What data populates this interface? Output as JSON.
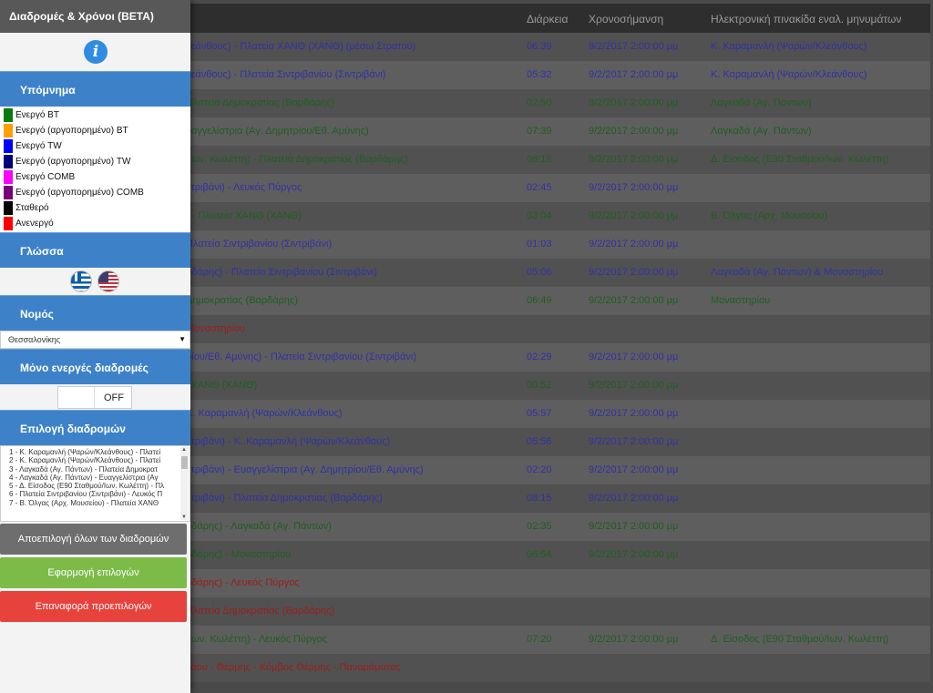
{
  "table": {
    "header": {
      "duration": "Διάρκεια",
      "timestamp": "Χρονοσήμανση",
      "sign": "Ηλεκτρονική πινακίδα εναλ. μηνυμάτων"
    },
    "rows": [
      {
        "route": "λεάνθους) - Πλατεία ΧΑΝΘ (ΧΑΝΘ) (μέσω Στρατού)",
        "duration": "06:39",
        "timestamp": "9/2/2017 2:00:00 μμ",
        "sign": "Κ. Καραμανλή (Ψαρών/Κλεάνθους)",
        "status": "blue"
      },
      {
        "route": "λεάνθους) - Πλατεία Σιντριβανίου (Σιντριβάνι)",
        "duration": "05:32",
        "timestamp": "9/2/2017 2:00:00 μμ",
        "sign": "Κ. Καραμανλή (Ψαρών/Κλεάνθους)",
        "status": "blue"
      },
      {
        "route": "Πλατεία Δημοκρατίας (Βαρδάρης)",
        "duration": "02:50",
        "timestamp": "9/2/2017 2:00:00 μμ",
        "sign": "Λαγκαδά (Αγ. Πάντων)",
        "status": "green"
      },
      {
        "route": "υαγγελίστρια (Αγ. Δημητρίου/Εθ. Αμύνης)",
        "duration": "07:39",
        "timestamp": "9/2/2017 2:00:00 μμ",
        "sign": "Λαγκαδά (Αγ. Πάντων)",
        "status": "green"
      },
      {
        "route": "/Ιων. Κωλέττη) - Πλατεία Δημοκρατίας (Βαρδάρης)",
        "duration": "06:18",
        "timestamp": "9/2/2017 2:00:00 μμ",
        "sign": "Δ. Είσοδος (Ε90 Σταθμού/Ιων. Κωλέττη)",
        "status": "green"
      },
      {
        "route": "ντριβάνι) - Λευκός Πύργος",
        "duration": "02:45",
        "timestamp": "9/2/2017 2:00:00 μμ",
        "sign": "",
        "status": "blue"
      },
      {
        "route": ") - Πλατεία ΧΑΝΘ (ΧΑΝΘ)",
        "duration": "03:04",
        "timestamp": "9/2/2017 2:00:00 μμ",
        "sign": "Β. Όλγας (Αρχ. Μουσείου)",
        "status": "green"
      },
      {
        "route": "Πλατεία Σιντριβανίου (Σιντριβάνι)",
        "duration": "01:03",
        "timestamp": "9/2/2017 2:00:00 μμ",
        "sign": "",
        "status": "blue"
      },
      {
        "route": "ρδάρης) - Πλατεία Σιντριβανίου (Σιντριβάνι)",
        "duration": "05:06",
        "timestamp": "9/2/2017 2:00:00 μμ",
        "sign": "Λαγκαδά (Αγ. Πάντων) & Μοναστηρίου",
        "status": "blue"
      },
      {
        "route": "Δημοκρατίας (Βαρδάρης)",
        "duration": "06:49",
        "timestamp": "9/2/2017 2:00:00 μμ",
        "sign": "Μοναστηρίου",
        "status": "green"
      },
      {
        "route": "Μοναστηρίου",
        "duration": "",
        "timestamp": "",
        "sign": "",
        "status": "red"
      },
      {
        "route": "ρίου/Εθ. Αμύνης) - Πλατεία Σιντριβανίου (Σιντριβάνι)",
        "duration": "02:29",
        "timestamp": "9/2/2017 2:00:00 μμ",
        "sign": "",
        "status": "blue"
      },
      {
        "route": "ι ΧΑΝΘ (ΧΑΝΘ)",
        "duration": "00:52",
        "timestamp": "9/2/2017 2:00:00 μμ",
        "sign": "",
        "status": "green"
      },
      {
        "route": "Κ. Καραμανλή (Ψαρών/Κλεάνθους)",
        "duration": "05:57",
        "timestamp": "9/2/2017 2:00:00 μμ",
        "sign": "",
        "status": "blue"
      },
      {
        "route": "ντριβάνι) - Κ. Καραμανλή (Ψαρών/Κλεάνθους)",
        "duration": "05:56",
        "timestamp": "9/2/2017 2:00:00 μμ",
        "sign": "",
        "status": "blue"
      },
      {
        "route": "ντριβάνι) - Ευαγγελίστρια (Αγ. Δημητρίου/Εθ. Αμύνης)",
        "duration": "02:20",
        "timestamp": "9/2/2017 2:00:00 μμ",
        "sign": "",
        "status": "blue"
      },
      {
        "route": "ντριβάνι) - Πλατεία Δημοκρατίας (Βαρδάρης)",
        "duration": "08:15",
        "timestamp": "9/2/2017 2:00:00 μμ",
        "sign": "",
        "status": "blue"
      },
      {
        "route": "ρδάρης) - Λαγκαδά (Αγ. Πάντων)",
        "duration": "02:35",
        "timestamp": "9/2/2017 2:00:00 μμ",
        "sign": "",
        "status": "green"
      },
      {
        "route": "ρδάρης) - Μοναστηρίου",
        "duration": "06:54",
        "timestamp": "9/2/2017 2:00:00 μμ",
        "sign": "",
        "status": "green"
      },
      {
        "route": "ρδάρης) - Λευκός Πύργος",
        "duration": "",
        "timestamp": "",
        "sign": "",
        "status": "red"
      },
      {
        "route": "Πλατεία Δημοκρατίας (Βαρδάρης)",
        "duration": "",
        "timestamp": "",
        "sign": "",
        "status": "red"
      },
      {
        "route": "/Ιων. Κωλέττη) - Λευκός Πύργος",
        "duration": "07:20",
        "timestamp": "9/2/2017 2:00:00 μμ",
        "sign": "Δ. Είσοδος (Ε90 Σταθμού/Ιων. Κωλέττη)",
        "status": "green"
      },
      {
        "route": "λάου - Θέρμης - Κόμβος Θέρμης - Πανοράματος",
        "duration": "",
        "timestamp": "",
        "sign": "",
        "status": "red"
      }
    ]
  },
  "sidebar": {
    "title": "Διαδρομές & Χρόνοι (BETA)",
    "info_icon": "info-icon",
    "legend": {
      "heading": "Υπόμνημα",
      "items": [
        {
          "label": "Ενεργό BT",
          "color": "#0a7a0a"
        },
        {
          "label": "Ενεργό (αργοπορημένο) BT",
          "color": "#ff9f00"
        },
        {
          "label": "Ενεργό TW",
          "color": "#0000ff"
        },
        {
          "label": "Ενεργό (αργοπορημένο) TW",
          "color": "#00007a"
        },
        {
          "label": "Ενεργό COMB",
          "color": "#ff00ff"
        },
        {
          "label": "Ενεργό (αργοπορημένο) COMB",
          "color": "#7a007a"
        },
        {
          "label": "Σταθερό",
          "color": "#000000"
        },
        {
          "label": "Ανενεργό",
          "color": "#ff0000"
        }
      ]
    },
    "language": {
      "heading": "Γλώσσα"
    },
    "prefecture": {
      "heading": "Νομός",
      "selected": "Θεσσαλονίκης"
    },
    "active_only": {
      "heading": "Μόνο ενεργές διαδρομές",
      "toggle_label": "OFF"
    },
    "route_select": {
      "heading": "Επιλογή διαδρομών",
      "options": [
        "1 - Κ. Καραμανλή (Ψαρών/Κλεάνθους) - Πλατεί",
        "2 - Κ. Καραμανλή (Ψαρών/Κλεάνθους) - Πλατεί",
        "3 - Λαγκαδά (Αγ. Πάντων) - Πλατεία Δημοκρατ",
        "4 - Λαγκαδά (Αγ. Πάντων) - Ευαγγελίστρια (Αγ",
        "5 - Δ. Είσοδος (Ε90 Σταθμού/Ιων. Κωλέττη) - Πλ",
        "6 - Πλατεία Σιντριβανίου (Σιντριβάνι) - Λευκός Π",
        "7 - Β. Όλγας (Αρχ. Μουσείου) - Πλατεία ΧΑΝΘ"
      ]
    },
    "buttons": {
      "deselect": "Αποεπιλογή όλων των διαδρομών",
      "apply": "Εφαρμογή επιλογών",
      "reset": "Επαναφορά προεπιλογών"
    }
  }
}
